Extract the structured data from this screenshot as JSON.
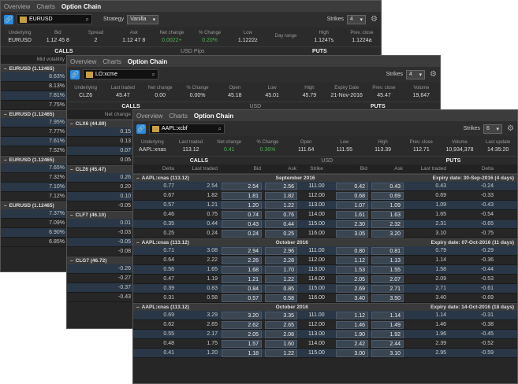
{
  "w1": {
    "tabs": [
      "Overview",
      "Charts",
      "Option Chain"
    ],
    "symbol": "EURUSD",
    "strategy_label": "Strategy",
    "strategy": "Vanilla",
    "strikes_label": "Strikes",
    "strikes": "4",
    "quote": [
      {
        "l": "Underlying",
        "v": "EURUSD"
      },
      {
        "l": "Bid",
        "v": "1.12 45 8"
      },
      {
        "l": "Spread",
        "v": "2"
      },
      {
        "l": "Ask",
        "v": "1.12 47 8"
      },
      {
        "l": "Net change",
        "v": "0.0022+"
      },
      {
        "l": "% Change",
        "v": "0.20%"
      },
      {
        "l": "Low",
        "v": "1.1222z"
      },
      {
        "l": "Day range",
        "v": ""
      },
      {
        "l": "High",
        "v": "1.1247s"
      },
      {
        "l": "Prev. close",
        "v": "1.1224a"
      }
    ],
    "pips": "USD Pips",
    "calls": "CALLS",
    "puts": "PUTS",
    "col": "Mid volatility",
    "groups": [
      {
        "name": "EURUSD (1.12465)",
        "vals": [
          "8.63%",
          "8.13%",
          "7.81%",
          "7.75%"
        ]
      },
      {
        "name": "EURUSD (1.12465)",
        "vals": [
          "7.95%",
          "7.77%",
          "7.61%",
          "7.52%"
        ]
      },
      {
        "name": "EURUSD (1.12465)",
        "vals": [
          "7.65%",
          "7.32%",
          "7.10%",
          "7.12%"
        ]
      },
      {
        "name": "EURUSD (1.12465)",
        "vals": [
          "7.37%",
          "7.09%",
          "6.90%",
          "6.85%"
        ]
      }
    ]
  },
  "w2": {
    "tabs": [
      "Overview",
      "Charts",
      "Option Chain"
    ],
    "symbol": "LO:xcme",
    "strikes_label": "Strikes",
    "strikes": "4",
    "quote": [
      {
        "l": "Underlying",
        "v": "CLZ6"
      },
      {
        "l": "Last traded",
        "v": "45.47"
      },
      {
        "l": "Net change",
        "v": "0.00"
      },
      {
        "l": "% Change",
        "v": "0.00%"
      },
      {
        "l": "Open",
        "v": "45.18"
      },
      {
        "l": "Low",
        "v": "45.01"
      },
      {
        "l": "High",
        "v": "45.79"
      },
      {
        "l": "Expiry Date",
        "v": "21-Nov-2016"
      },
      {
        "l": "Prev. close",
        "v": "45.47"
      },
      {
        "l": "Volume",
        "v": "19,647"
      }
    ],
    "calls": "CALLS",
    "usd": "USD",
    "puts": "PUTS",
    "col": "Net change",
    "groups": [
      {
        "name": "CLX6 (44.89)",
        "vals": [
          "0.15",
          "0.13",
          "0.07",
          "0.05"
        ]
      },
      {
        "name": "CLZ6 (45.47)",
        "vals": [
          "0.26",
          "0.20",
          "0.10",
          "-0.05"
        ]
      },
      {
        "name": "CLF7 (46.10)",
        "vals": [
          "0.01",
          "-0.03",
          "-0.05",
          "-0.08"
        ]
      },
      {
        "name": "CLG7 (46.72)",
        "vals": [
          "-0.26",
          "-0.27",
          "-0.37",
          "-0.43"
        ]
      }
    ]
  },
  "w3": {
    "tabs": [
      "Overview",
      "Charts",
      "Option Chain"
    ],
    "symbol": "AAPL:xcbf",
    "strikes_label": "Strikes",
    "strikes": "6",
    "quote": [
      {
        "l": "Underlying",
        "v": "AAPL:xnas"
      },
      {
        "l": "Last traded",
        "v": "113.12"
      },
      {
        "l": "Net change",
        "v": "0.41"
      },
      {
        "l": "% Change",
        "v": "0.36%"
      },
      {
        "l": "Open",
        "v": "111.64"
      },
      {
        "l": "Low",
        "v": "111.55"
      },
      {
        "l": "High",
        "v": "113.39"
      },
      {
        "l": "Prev. close",
        "v": "112.71"
      },
      {
        "l": "Volume",
        "v": "10,934,378"
      },
      {
        "l": "Last update",
        "v": "14:35:20"
      }
    ],
    "calls": "CALLS",
    "usd": "USD",
    "puts": "PUTS",
    "cols": [
      "Delta",
      "Last traded",
      "Bid",
      "Ask",
      "Strike",
      "Bid",
      "Ask",
      "Last traded",
      "Delta"
    ],
    "sections": [
      {
        "name": "AAPL:xnas (113.12)",
        "month": "September 2016",
        "exp": "Expiry date: 30-Sep-2016 (4 days)",
        "rows": [
          [
            "0.77",
            "2.54",
            "2.54",
            "2.56",
            "111.00",
            "0.42",
            "0.43",
            "0.43",
            "-0.24"
          ],
          [
            "0.67",
            "1.82",
            "1.81",
            "1.82",
            "112.00",
            "0.68",
            "0.69",
            "0.69",
            "-0.33"
          ],
          [
            "0.57",
            "1.21",
            "1.20",
            "1.22",
            "113.00",
            "1.07",
            "1.09",
            "1.09",
            "-0.43"
          ],
          [
            "0.46",
            "0.75",
            "0.74",
            "0.76",
            "114.00",
            "1.61",
            "1.63",
            "1.65",
            "-0.54"
          ],
          [
            "0.35",
            "0.44",
            "0.43",
            "0.44",
            "115.00",
            "2.30",
            "2.32",
            "2.31",
            "-0.65"
          ],
          [
            "0.25",
            "0.24",
            "0.24",
            "0.25",
            "116.00",
            "3.05",
            "3.20",
            "3.10",
            "-0.75"
          ]
        ]
      },
      {
        "name": "AAPL:xnas (113.12)",
        "month": "October 2016",
        "exp": "Expiry date: 07-Oct-2016 (11 days)",
        "rows": [
          [
            "0.71",
            "3.08",
            "2.94",
            "2.96",
            "111.00",
            "0.80",
            "0.81",
            "0.79",
            "-0.29"
          ],
          [
            "0.64",
            "2.22",
            "2.26",
            "2.28",
            "112.00",
            "1.12",
            "1.13",
            "1.14",
            "-0.36"
          ],
          [
            "0.56",
            "1.65",
            "1.68",
            "1.70",
            "113.00",
            "1.53",
            "1.55",
            "1.58",
            "-0.44"
          ],
          [
            "0.47",
            "1.19",
            "1.21",
            "1.22",
            "114.00",
            "2.05",
            "2.07",
            "2.09",
            "-0.53"
          ],
          [
            "0.39",
            "0.83",
            "0.84",
            "0.85",
            "115.00",
            "2.69",
            "2.71",
            "2.71",
            "-0.61"
          ],
          [
            "0.31",
            "0.58",
            "0.57",
            "0.58",
            "116.00",
            "3.40",
            "3.50",
            "3.40",
            "-0.69"
          ]
        ]
      },
      {
        "name": "AAPL:xnas (113.12)",
        "month": "October 2016",
        "exp": "Expiry date: 14-Oct-2016 (18 days)",
        "rows": [
          [
            "0.69",
            "3.29",
            "3.20",
            "3.35",
            "111.00",
            "1.12",
            "1.14",
            "1.14",
            "-0.31"
          ],
          [
            "0.62",
            "2.65",
            "2.62",
            "2.65",
            "112.00",
            "1.46",
            "1.49",
            "1.46",
            "-0.38"
          ],
          [
            "0.55",
            "2.17",
            "2.05",
            "2.08",
            "113.00",
            "1.90",
            "1.92",
            "1.96",
            "-0.45"
          ],
          [
            "0.48",
            "1.75",
            "1.57",
            "1.60",
            "114.00",
            "2.42",
            "2.44",
            "2.39",
            "-0.52"
          ],
          [
            "0.41",
            "1.20",
            "1.18",
            "1.22",
            "115.00",
            "3.00",
            "3.10",
            "2.95",
            "-0.59"
          ]
        ]
      }
    ]
  }
}
